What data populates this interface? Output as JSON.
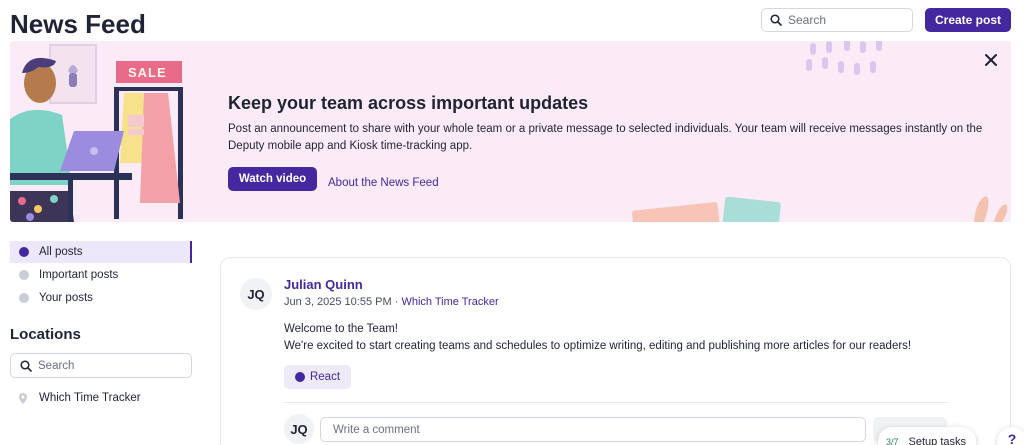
{
  "header": {
    "title": "News Feed",
    "search_placeholder": "Search",
    "create_label": "Create post"
  },
  "banner": {
    "sale_text": "SALE",
    "heading": "Keep your team across important updates",
    "text": "Post an announcement to share with your whole team or a private message to selected individuals. Your team will receive messages instantly on the Deputy mobile app and Kiosk time-tracking app.",
    "watch_label": "Watch video",
    "about_label": "About the News Feed"
  },
  "sidebar": {
    "items": [
      {
        "label": "All posts",
        "active": true
      },
      {
        "label": "Important posts",
        "active": false
      },
      {
        "label": "Your posts",
        "active": false
      }
    ],
    "locations_heading": "Locations",
    "location_search_placeholder": "Search",
    "locations": [
      {
        "label": "Which Time Tracker"
      }
    ]
  },
  "post": {
    "avatar_initials": "JQ",
    "author": "Julian Quinn",
    "timestamp": "Jun 3, 2025 10:55 PM",
    "separator": "·",
    "location": "Which Time Tracker",
    "body_line1": "Welcome to the Team!",
    "body_line2": "We're excited to start creating teams and schedules to optimize writing, editing and publishing more articles for our readers!",
    "react_label": "React",
    "commenter_initials": "JQ",
    "comment_placeholder": "Write a comment"
  },
  "setup_tasks": {
    "count": "3/7",
    "label": "Setup tasks"
  },
  "help": {
    "glyph": "?"
  },
  "colors": {
    "accent": "#4527a0",
    "banner_bg": "#fbebf6",
    "active_bg": "#ede7fb"
  }
}
